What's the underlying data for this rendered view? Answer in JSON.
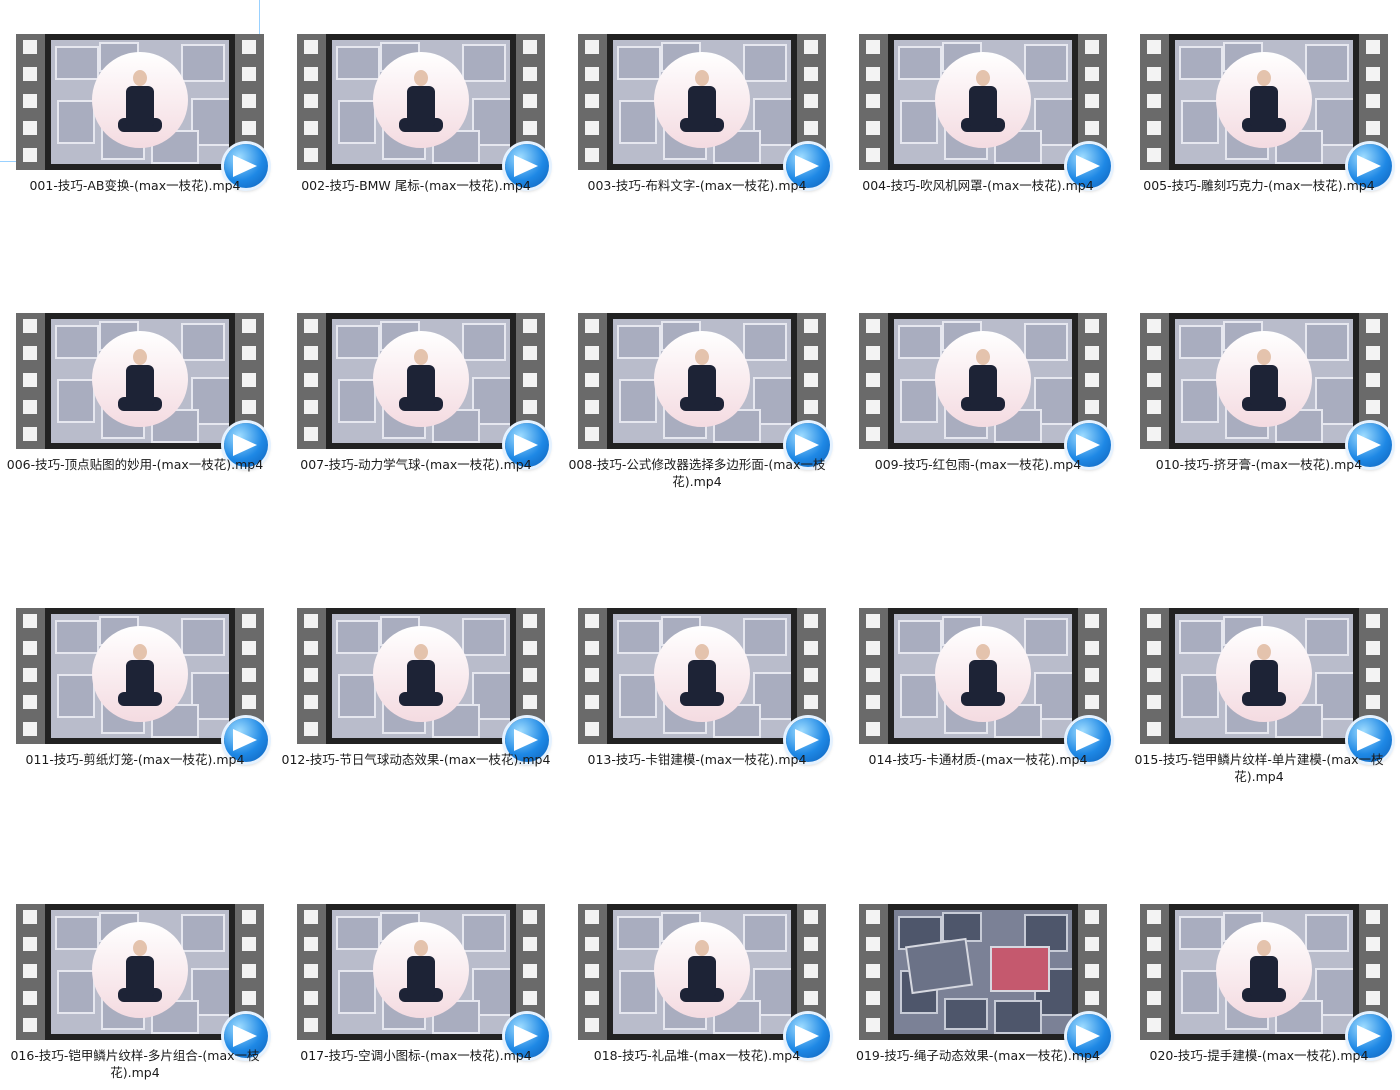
{
  "files": [
    {
      "name": "001-技巧-AB变换-(max一枝花).mp4",
      "selected": true
    },
    {
      "name": "002-技巧-BMW 尾标-(max一枝花).mp4"
    },
    {
      "name": "003-技巧-布料文字-(max一枝花).mp4"
    },
    {
      "name": "004-技巧-吹风机网罩-(max一枝花).mp4"
    },
    {
      "name": "005-技巧-雕刻巧克力-(max一枝花).mp4"
    },
    {
      "name": "006-技巧-顶点贴图的妙用-(max一枝花).mp4"
    },
    {
      "name": "007-技巧-动力学气球-(max一枝花).mp4"
    },
    {
      "name": "008-技巧-公式修改器选择多边形面-(max一枝花).mp4"
    },
    {
      "name": "009-技巧-红包雨-(max一枝花).mp4"
    },
    {
      "name": "010-技巧-挤牙膏-(max一枝花).mp4"
    },
    {
      "name": "011-技巧-剪纸灯笼-(max一枝花).mp4"
    },
    {
      "name": "012-技巧-节日气球动态效果-(max一枝花).mp4"
    },
    {
      "name": "013-技巧-卡钳建模-(max一枝花).mp4"
    },
    {
      "name": "014-技巧-卡通材质-(max一枝花).mp4"
    },
    {
      "name": "015-技巧-铠甲鳞片纹样-单片建模-(max一枝花).mp4"
    },
    {
      "name": "016-技巧-铠甲鳞片纹样-多片组合-(max一枝花).mp4"
    },
    {
      "name": "017-技巧-空调小图标-(max一枝花).mp4"
    },
    {
      "name": "018-技巧-礼品堆-(max一枝花).mp4"
    },
    {
      "name": "019-技巧-绳子动态效果-(max一枝花).mp4",
      "thumbnail": "alternate"
    },
    {
      "name": "020-技巧-提手建模-(max一枝花).mp4"
    }
  ],
  "icons": {
    "overlay": "play-arrow-icon"
  },
  "colors": {
    "selection_border": "#99d1ff",
    "film_strip": "#6a6a6a",
    "play_badge": "#1e88e5"
  }
}
